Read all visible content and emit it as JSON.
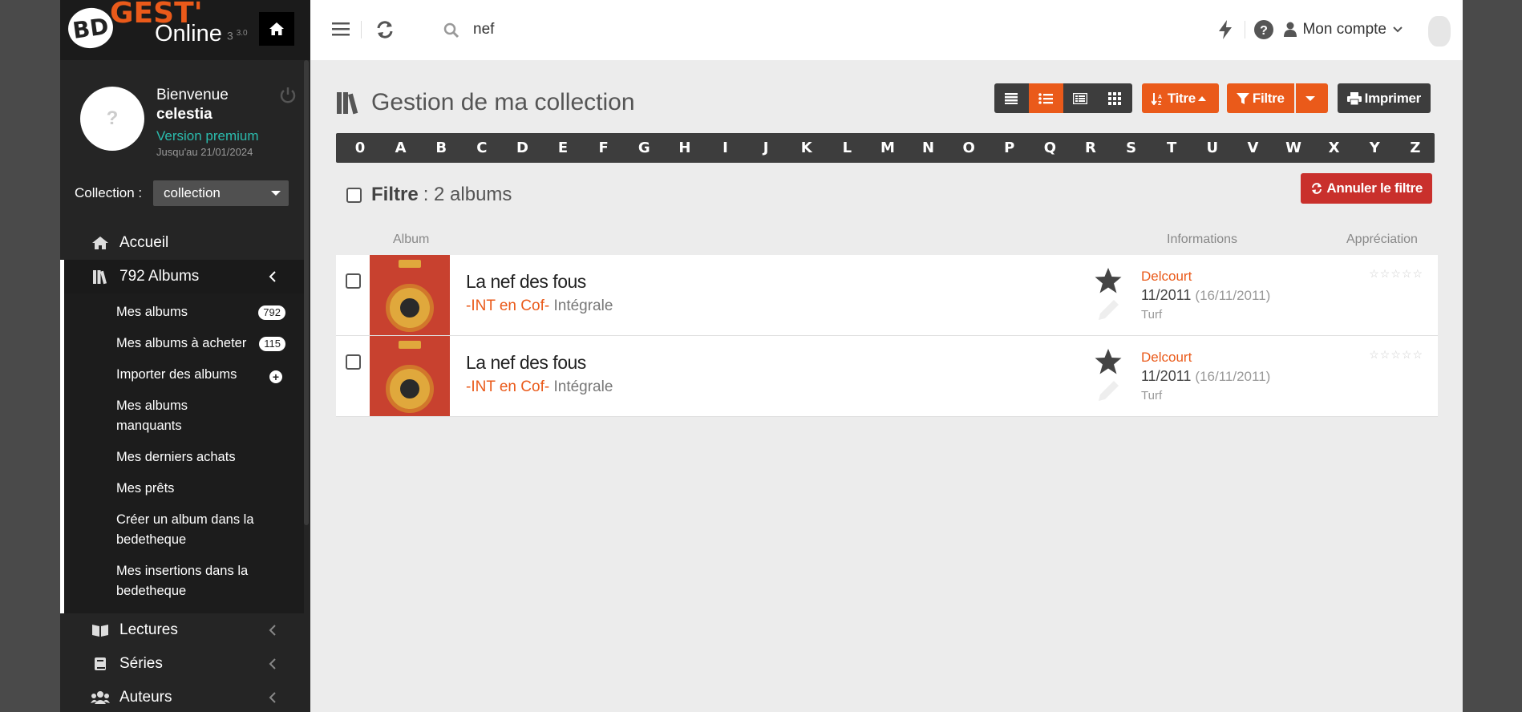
{
  "logo": {
    "bd": "BD",
    "gest": "GEST'",
    "online": "Online",
    "version": "3",
    "version_minor": "3.0"
  },
  "user": {
    "welcome": "Bienvenue",
    "name": "celestia",
    "plan": "Version premium",
    "until": "Jusqu'au 21/01/2024",
    "avatar": "?"
  },
  "collection": {
    "label": "Collection :",
    "value": "collection"
  },
  "nav": {
    "home": "Accueil",
    "albums": "792 Albums",
    "sub": [
      {
        "label": "Mes albums",
        "badge": "792"
      },
      {
        "label": "Mes albums à acheter",
        "badge": "115"
      },
      {
        "label": "Importer des albums",
        "badge": "+"
      },
      {
        "label": "Mes albums manquants"
      },
      {
        "label": "Mes derniers achats"
      },
      {
        "label": "Mes prêts"
      },
      {
        "label": "Créer un album dans la bedetheque"
      },
      {
        "label": "Mes insertions dans la bedetheque"
      }
    ],
    "lectures": "Lectures",
    "series": "Séries",
    "auteurs": "Auteurs"
  },
  "topbar": {
    "search_value": "nef",
    "account": "Mon compte"
  },
  "page": {
    "title": "Gestion de ma collection"
  },
  "toolbar": {
    "sort": "Titre",
    "filter": "Filtre",
    "print": "Imprimer",
    "cancel_filter": "Annuler le filtre"
  },
  "alphabet": [
    "0",
    "A",
    "B",
    "C",
    "D",
    "E",
    "F",
    "G",
    "H",
    "I",
    "J",
    "K",
    "L",
    "M",
    "N",
    "O",
    "P",
    "Q",
    "R",
    "S",
    "T",
    "U",
    "V",
    "W",
    "X",
    "Y",
    "Z"
  ],
  "filter": {
    "label": "Filtre",
    "count": ": 2 albums"
  },
  "columns": {
    "album": "Album",
    "info": "Informations",
    "rating": "Appréciation"
  },
  "albums": [
    {
      "title": "La nef des fous",
      "serie": "-INT en Cof-",
      "type": "Intégrale",
      "publisher": "Delcourt",
      "date": "11/2011",
      "date2": "(16/11/2011)",
      "collection": "Turf",
      "rating": "☆☆☆☆☆"
    },
    {
      "title": "La nef des fous",
      "serie": "-INT en Cof-",
      "type": "Intégrale",
      "publisher": "Delcourt",
      "date": "11/2011",
      "date2": "(16/11/2011)",
      "collection": "Turf",
      "rating": "☆☆☆☆☆"
    }
  ],
  "colors": {
    "accent": "#ea5a1a",
    "danger": "#c9302c",
    "dark": "#3d3d3d",
    "premium": "#2bbbad"
  }
}
